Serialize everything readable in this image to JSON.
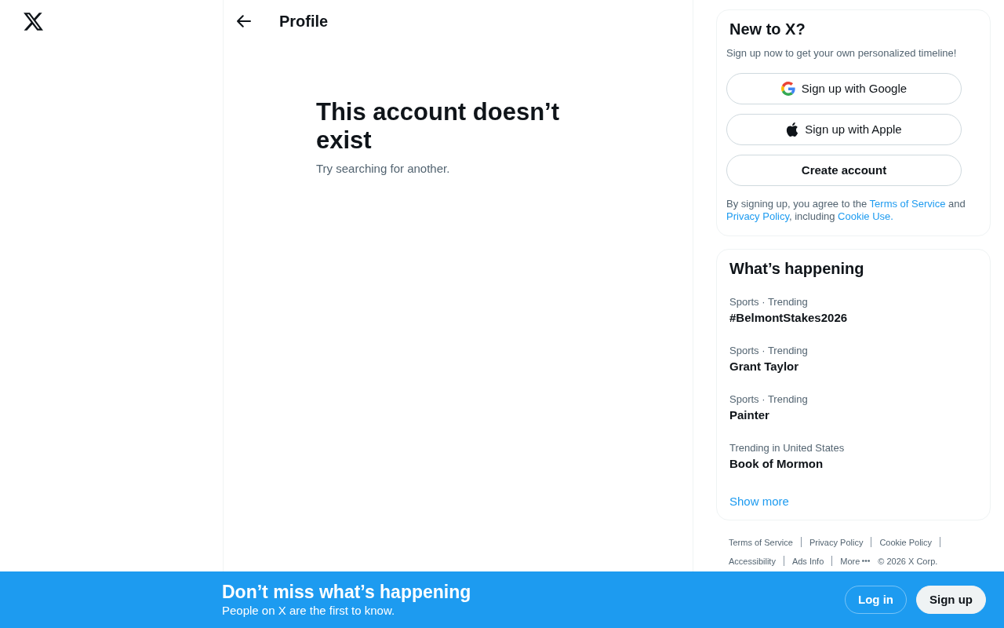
{
  "header": {
    "title": "Profile"
  },
  "empty_state": {
    "title": "This account doesn’t exist",
    "message": "Try searching for another."
  },
  "signup_card": {
    "title": "New to X?",
    "subtitle": "Sign up now to get your own personalized timeline!",
    "buttons": [
      {
        "kind": "google",
        "label": "Sign up with Google"
      },
      {
        "kind": "apple",
        "label": "Sign up with Apple"
      },
      {
        "kind": "create",
        "label": "Create account"
      }
    ],
    "terms": [
      {
        "kind": "text",
        "text": "By signing up, you agree to the "
      },
      {
        "kind": "link",
        "text": "Terms of Service"
      },
      {
        "kind": "text",
        "text": " and "
      },
      {
        "kind": "link",
        "text": "Privacy Policy"
      },
      {
        "kind": "text",
        "text": ", including "
      },
      {
        "kind": "link",
        "text": "Cookie Use."
      }
    ]
  },
  "trends": {
    "title": "What’s happening",
    "items": [
      {
        "context": "Sports · Trending",
        "name": "#BelmontStakes2026"
      },
      {
        "context": "Sports · Trending",
        "name": "Grant Taylor"
      },
      {
        "context": "Sports · Trending",
        "name": "Painter"
      },
      {
        "context": "Trending in United States",
        "name": "Book of Mormon"
      }
    ],
    "show_more": "Show more"
  },
  "footer": {
    "links": [
      {
        "kind": "link",
        "label": "Terms of Service"
      },
      {
        "kind": "link",
        "label": "Privacy Policy"
      },
      {
        "kind": "link",
        "label": "Cookie Policy"
      },
      {
        "kind": "link",
        "label": "Accessibility"
      },
      {
        "kind": "link",
        "label": "Ads Info"
      },
      {
        "kind": "menu",
        "label": "More"
      }
    ],
    "copyright": "© 2026 X Corp."
  },
  "banner": {
    "title": "Don’t miss what’s happening",
    "subtitle": "People on X are the first to know.",
    "buttons": [
      {
        "kind": "outline",
        "label": "Log in"
      },
      {
        "kind": "solid",
        "label": "Sign up"
      }
    ]
  }
}
